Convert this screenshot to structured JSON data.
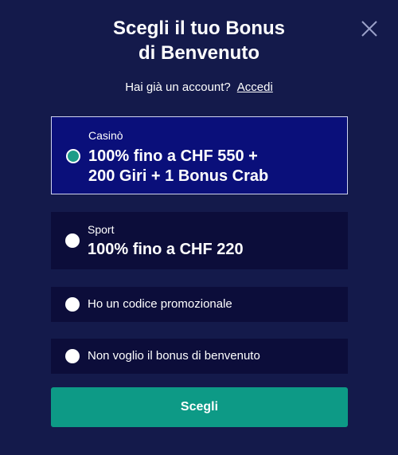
{
  "dialog": {
    "title_line1": "Scegli il tuo Bonus",
    "title_line2": "di Benvenuto",
    "close_icon": "close-icon"
  },
  "account": {
    "prompt": "Hai già un account?",
    "login_link": "Accedi"
  },
  "options": [
    {
      "category": "Casinò",
      "line1": "100% fino a CHF 550 +",
      "line2": "200 Giri + 1 Bonus Crab",
      "selected": true
    },
    {
      "category": "Sport",
      "line1": "100% fino a CHF 220",
      "selected": false
    },
    {
      "label": "Ho un codice promozionale",
      "selected": false
    },
    {
      "label": "Non voglio il bonus di benvenuto",
      "selected": false
    }
  ],
  "submit": {
    "label": "Scegli"
  },
  "colors": {
    "background": "#141a4b",
    "selected_option": "#0a0f7a",
    "option": "#0c0d3a",
    "accent": "#0d9a86"
  }
}
